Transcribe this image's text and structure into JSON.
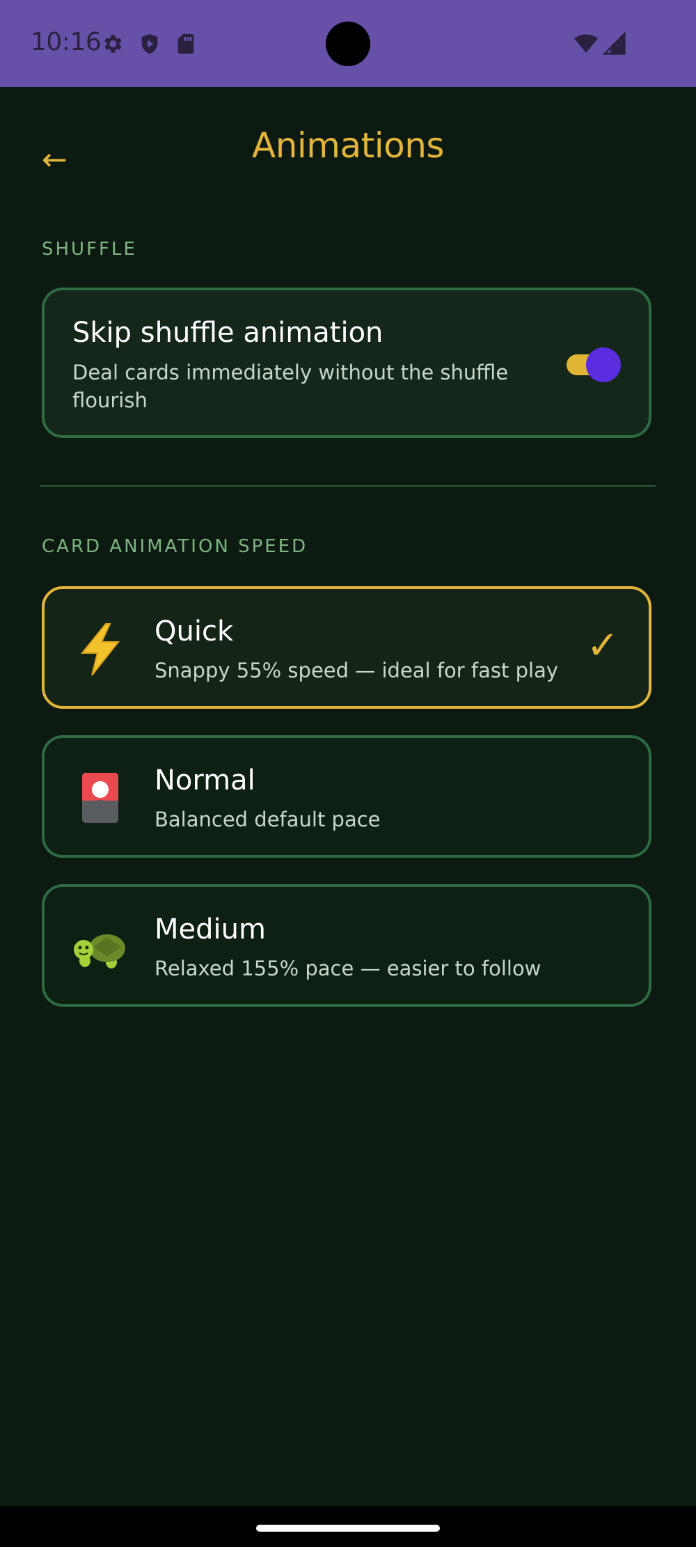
{
  "status_bar": {
    "time": "10:16",
    "icons": [
      "gear-icon",
      "shield-icon",
      "sd-card-icon",
      "wifi-icon",
      "signal-icon"
    ]
  },
  "header": {
    "back_icon": "←",
    "title": "Animations"
  },
  "shuffle_section": {
    "label": "SHUFFLE",
    "skip": {
      "title": "Skip shuffle animation",
      "description": "Deal cards immediately without the shuffle flourish",
      "enabled": true
    }
  },
  "speed_section": {
    "label": "CARD ANIMATION SPEED",
    "options": [
      {
        "icon": "lightning-icon",
        "title": "Quick",
        "description": "Snappy 55% speed — ideal for fast play",
        "selected": true
      },
      {
        "icon": "card-icon",
        "title": "Normal",
        "description": "Balanced default pace",
        "selected": false
      },
      {
        "icon": "turtle-icon",
        "title": "Medium",
        "description": "Relaxed 155% pace — easier to follow",
        "selected": false
      }
    ],
    "check_glyph": "✓"
  },
  "colors": {
    "accent": "#e3b53c",
    "background": "#0c1a11",
    "card_border": "#2e6a42",
    "toggle_thumb": "#5a2de0",
    "status_bar": "#6650a8"
  }
}
